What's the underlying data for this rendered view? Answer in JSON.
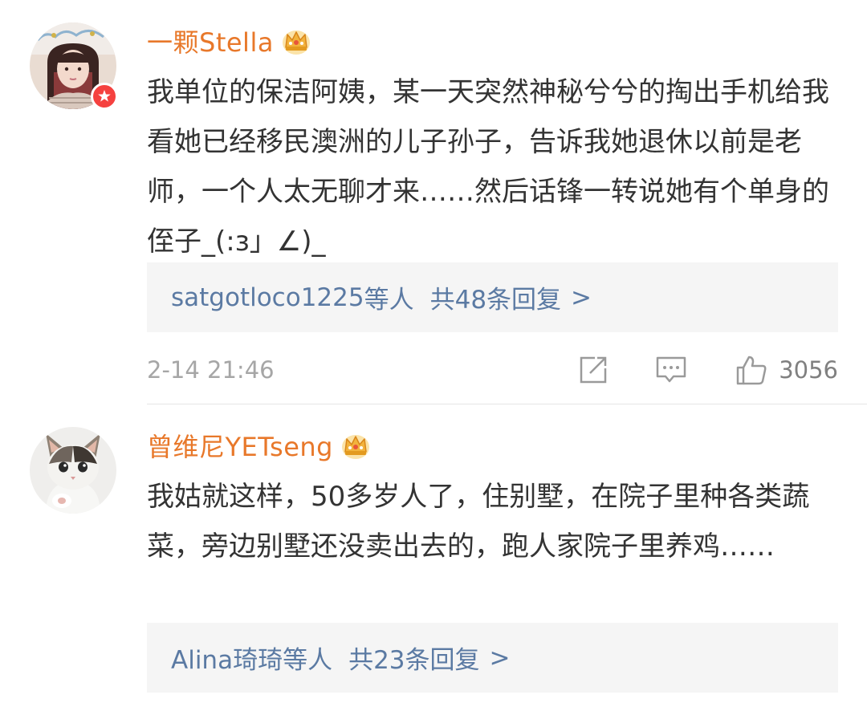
{
  "comments": [
    {
      "username": "一颗Stella",
      "text": "我单位的保洁阿姨，某一天突然神秘兮兮的掏出手机给我看她已经移民澳洲的儿子孙子，告诉我她退休以前是老师，一个人太无聊才来……然后话锋一转说她有个单身的侄子_(:з」∠)_",
      "reply_users": "satgotloco1225",
      "reply_suffix": "等人",
      "reply_count": "共48条回复",
      "reply_chevron": ">",
      "timestamp": "2-14 21:46",
      "likes": "3056",
      "avatar_icon": "avatar-girl-photo",
      "verified_icon": "verified-badge-icon"
    },
    {
      "username": "曾维尼YETseng",
      "text": "我姑就这样，50多岁人了，住别墅，在院子里种各类蔬菜，旁边别墅还没卖出去的，跑人家院子里养鸡……",
      "reply_users": "Alina琦琦",
      "reply_suffix": "等人",
      "reply_count": "共23条回复",
      "reply_chevron": ">",
      "avatar_icon": "avatar-kitten-photo"
    }
  ],
  "icons": {
    "crown": "crown-icon",
    "share": "share-icon",
    "reply": "comment-icon",
    "like": "thumbs-up-icon"
  },
  "colors": {
    "username": "#e8782a",
    "link": "#5b7aa3",
    "text": "#333333",
    "muted": "#a6a6a6",
    "reply_bg": "#f5f5f5",
    "badge_red": "#f5413f",
    "crown_gold": "#f2b33d"
  }
}
